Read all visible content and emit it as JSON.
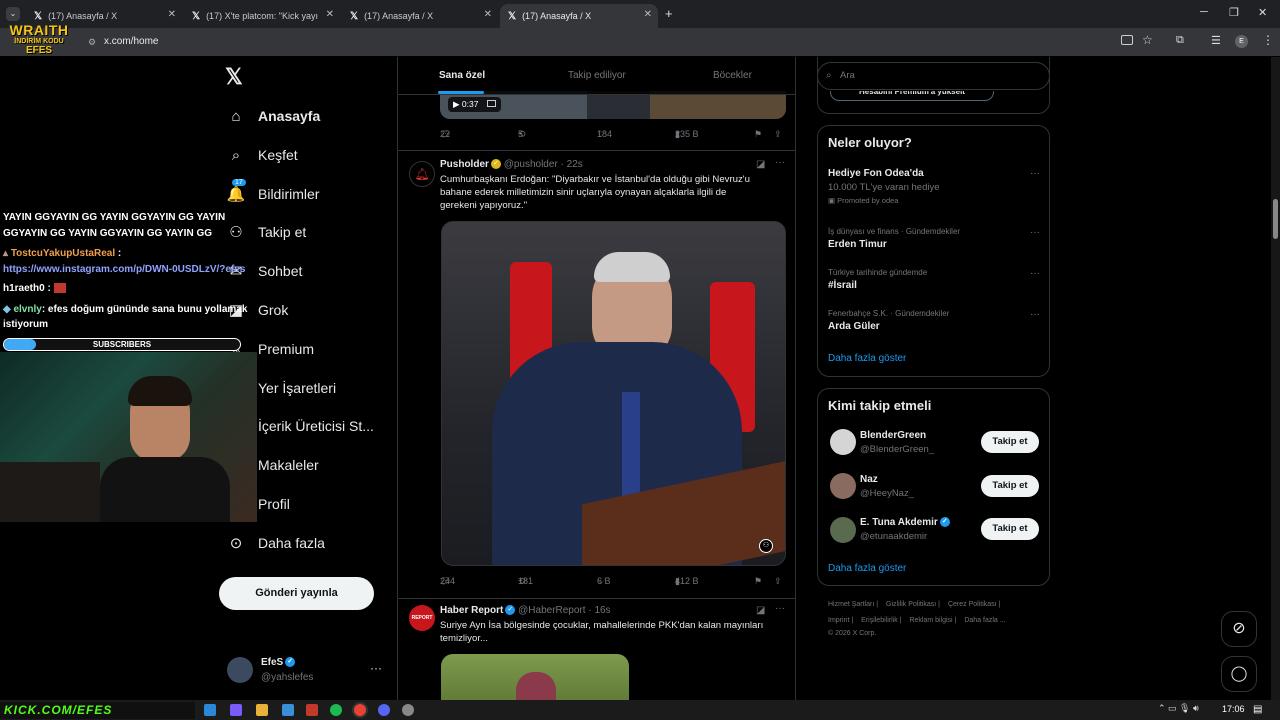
{
  "browser": {
    "tabs": [
      {
        "title": "(17) Anasayfa / X"
      },
      {
        "title": "(17) X'te platcom: \"Kick yayıncı..."
      },
      {
        "title": "(17) Anasayfa / X"
      },
      {
        "title": "(17) Anasayfa / X"
      }
    ],
    "url": "x.com/home"
  },
  "stream_overlay": {
    "logo_top": "WRAITH",
    "logo_mid": "İNDİRİM KODU",
    "logo_bot": "EFES",
    "chat_spam_1": "YAYIN GGYAYIN GG YAYIN GGYAYIN GG YAYIN",
    "chat_spam_2": "GGYAYIN GG YAYIN GGYAYIN GG YAYIN GG",
    "chat_user_1": "TostcuYakupUstaReal",
    "chat_link": "https://www.instagram.com/p/DWN-0USDLzV/?efes",
    "chat_user_2": "h1raeth0",
    "chat_user_3": "elvnly",
    "chat_msg_3": ": efes doğum gününde sana bunu yollamak istiyorum",
    "subs_label": "SUBSCRIBERS",
    "bottom_banner": "KICK.COM/EFES"
  },
  "nav": {
    "items": [
      {
        "label": "Anasayfa",
        "icon": "home-icon"
      },
      {
        "label": "Keşfet",
        "icon": "search-icon"
      },
      {
        "label": "Bildirimler",
        "icon": "bell-icon",
        "badge": "17"
      },
      {
        "label": "Takip et",
        "icon": "add-person-icon"
      },
      {
        "label": "Sohbet",
        "icon": "mail-icon"
      },
      {
        "label": "Grok",
        "icon": "grok-icon"
      },
      {
        "label": "Premium",
        "icon": "x-premium-icon"
      },
      {
        "label": "Yer İşaretleri",
        "icon": "bookmark-icon"
      },
      {
        "label": "İçerik Üreticisi St...",
        "icon": "studio-icon"
      },
      {
        "label": "Makaleler",
        "icon": "article-icon"
      },
      {
        "label": "Profil",
        "icon": "profile-icon"
      },
      {
        "label": "Daha fazla",
        "icon": "more-circle-icon"
      }
    ],
    "post_button": "Gönderi yayınla",
    "account": {
      "name": "EfeS",
      "handle": "@yahslefes"
    }
  },
  "timeline": {
    "tabs": [
      "Sana özel",
      "Takip ediliyor",
      "Böcekler"
    ],
    "video_time": "0:37",
    "prev_actions": {
      "replies": "22",
      "reposts": "5",
      "likes": "184",
      "views": "235 B"
    },
    "tweet1": {
      "name": "Pusholder",
      "handle": "@pusholder",
      "time": "22s",
      "text_1": "Cumhurbaşkanı Erdoğan: \"Diyarbakır ve İstanbul'da olduğu gibi Nevruz'u",
      "text_2": "bahane ederek milletimizin sinir uçlarıyla oynayan alçaklarla ilgili de",
      "text_3": "gerekeni yapıyoruz.\"",
      "replies": "244",
      "reposts": "181",
      "likes": "6 B",
      "views": "412 B"
    },
    "tweet2": {
      "name": "Haber Report",
      "handle": "@HaberReport",
      "time": "16s",
      "avatar_text": "REPORT",
      "text_1": "Suriye Ayn İsa bölgesinde çocuklar, mahallelerinde PKK'dan kalan mayınları",
      "text_2": "temizliyor..."
    }
  },
  "right": {
    "search_placeholder": "Ara",
    "premium_pill": "Hesabını Premium'a yükselt",
    "trends_title": "Neler oluyor?",
    "trends": [
      {
        "meta": "",
        "title": "Hediye Fon Odea'da",
        "sub": "10.000 TL'ye varan hediye",
        "promo": "Promoted by odea"
      },
      {
        "meta": "İş dünyası ve finans · Gündemdekiler",
        "title": "Erden Timur"
      },
      {
        "meta": "Türkiye tarihinde gündemde",
        "title": "#İsrail"
      },
      {
        "meta": "Fenerbahçe S.K. · Gündemdekiler",
        "title": "Arda Güler"
      }
    ],
    "show_more": "Daha fazla göster",
    "who_title": "Kimi takip etmeli",
    "who": [
      {
        "name": "BlenderGreen",
        "handle": "@BlenderGreen_"
      },
      {
        "name": "Naz",
        "handle": "@HeeyNaz_"
      },
      {
        "name": "E. Tuna Akdemir",
        "handle": "@etunaakdemir"
      }
    ],
    "follow_label": "Takip et",
    "footer_1": [
      "Hizmet Şartları",
      "Gizlilik Politikası",
      "Çerez Politikası"
    ],
    "footer_2": [
      "Imprint",
      "Erişilebilirlik",
      "Reklam bilgisi",
      "Daha fazla ..."
    ],
    "copyright": "© 2026 X Corp."
  },
  "taskbar": {
    "time": "17:06"
  }
}
